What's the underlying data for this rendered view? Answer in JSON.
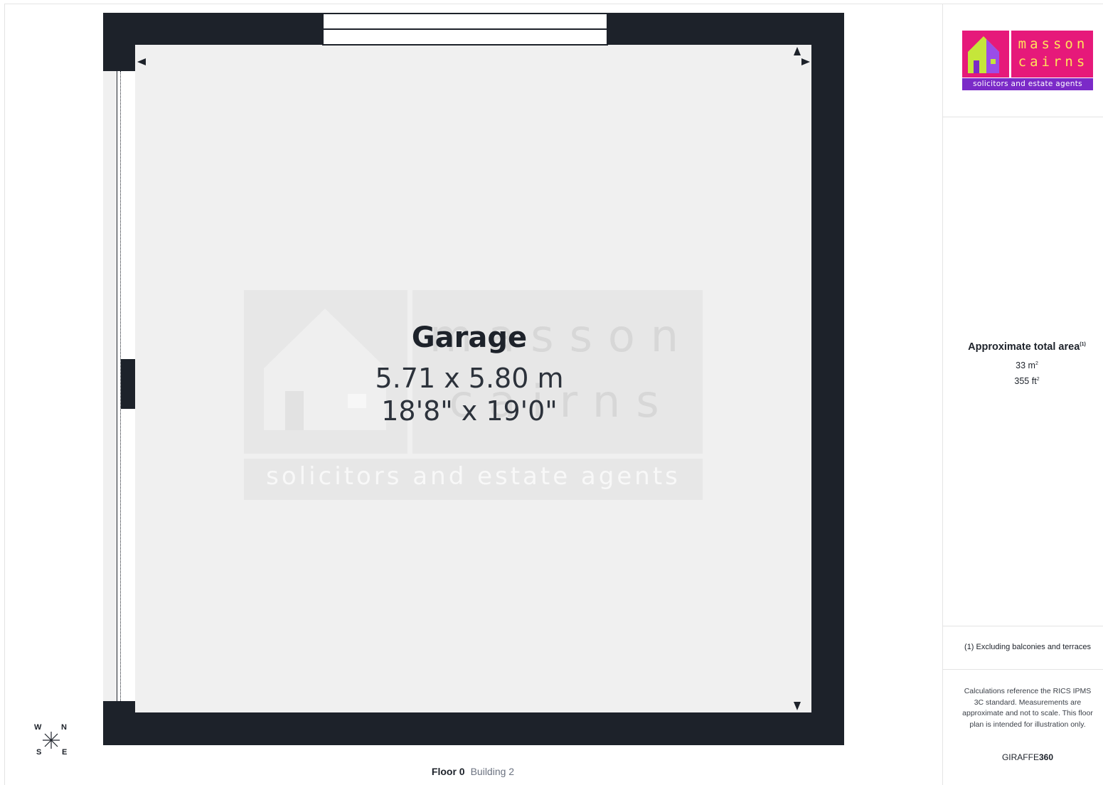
{
  "room": {
    "name": "Garage",
    "dim_metric": "5.71 x 5.80 m",
    "dim_imperial": "18'8\" x 19'0\""
  },
  "watermark": {
    "line1": "masson",
    "line2": "cairns",
    "tagline": "solicitors and estate agents"
  },
  "compass": {
    "w": "W",
    "n": "N",
    "s": "S",
    "e": "E"
  },
  "floor_info": {
    "floor": "Floor 0",
    "building": "Building 2"
  },
  "logo": {
    "line1": "masson",
    "line2": "cairns",
    "tagline": "solicitors and estate agents",
    "colors": {
      "pink": "#e6197a",
      "purple": "#7b2ac8",
      "yellow": "#ffe35a",
      "green": "#c5e63a"
    }
  },
  "area": {
    "title": "Approximate total area",
    "title_note": "(1)",
    "metric_value": "33 m",
    "metric_unit_sup": "2",
    "imperial_value": "355 ft",
    "imperial_unit_sup": "2"
  },
  "footnote": "(1) Excluding balconies and terraces",
  "calculation_note": "Calculations reference the RICS IPMS 3C standard. Measurements are approximate and not to scale. This floor plan is intended for illustration only.",
  "brand": {
    "part1": "GIRAFFE",
    "part2": "360"
  },
  "colors": {
    "wall": "#1d222a",
    "floor": "#f0f0f0"
  }
}
